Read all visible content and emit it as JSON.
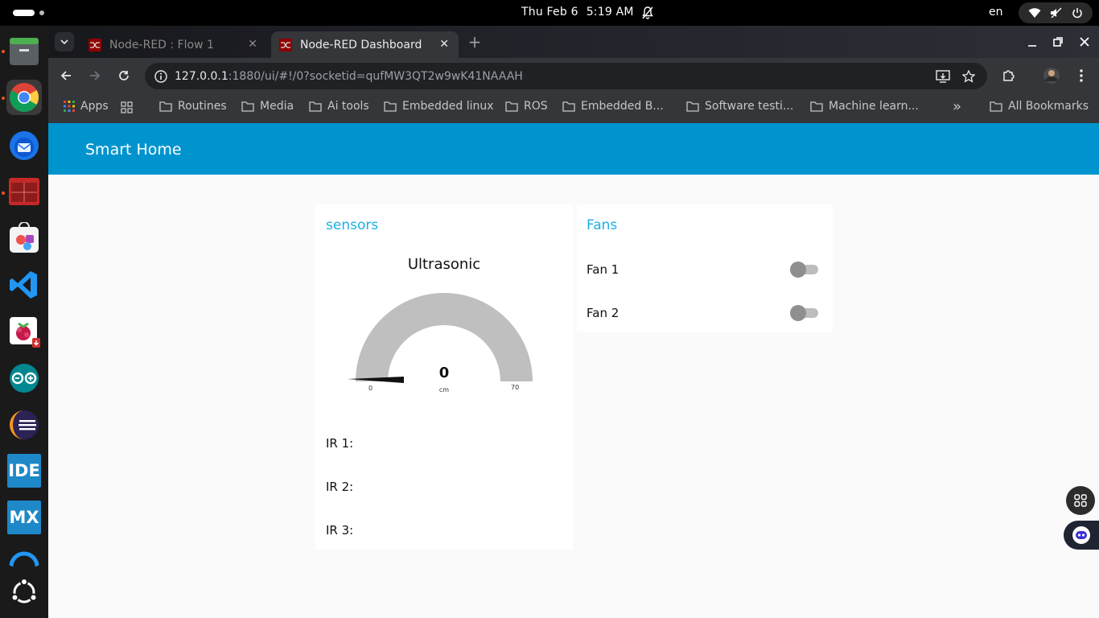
{
  "os": {
    "date": "Thu Feb 6",
    "time": "5:19 AM",
    "language": "en"
  },
  "dock": {
    "apps": [
      "files-icon",
      "chrome-icon",
      "thunderbird-icon",
      "terminal-app-icon",
      "app-center-icon",
      "vscode-icon",
      "raspberry-pi-imager-icon",
      "arduino-icon",
      "eclipse-icon",
      "ide-icon",
      "mx-icon",
      "arch-app-icon",
      "ubuntu-show-apps-icon"
    ],
    "ide_label": "IDE",
    "mx_label": "MX"
  },
  "browser": {
    "tabs": [
      {
        "title": "Node-RED : Flow 1",
        "active": false
      },
      {
        "title": "Node-RED Dashboard",
        "active": true
      }
    ],
    "url_host": "127.0.0.1",
    "url_rest": ":1880/ui/#!/0?socketid=qufMW3QT2w9wK41NAAAH",
    "bookmarks": [
      "Apps",
      "Routines",
      "Media",
      "Ai tools",
      "Embedded linux",
      "ROS",
      "Embedded B...",
      "Software testi...",
      "Machine learn...",
      "All Bookmarks"
    ],
    "more_bookmarks": "»"
  },
  "dashboard": {
    "title": "Smart Home",
    "sensors": {
      "title": "sensors",
      "gauge": {
        "label": "Ultrasonic",
        "value": "0",
        "units": "cm",
        "min": "0",
        "max": "70"
      },
      "ir_labels": [
        "IR 1:",
        "IR 2:",
        "IR 3:"
      ]
    },
    "fans": {
      "title": "Fans",
      "items": [
        {
          "label": "Fan 1",
          "on": false
        },
        {
          "label": "Fan 2",
          "on": false
        }
      ]
    }
  },
  "colors": {
    "accent": "#0094ce",
    "group_title": "#1bb0e6",
    "gauge_bg": "#bfbfbf"
  }
}
